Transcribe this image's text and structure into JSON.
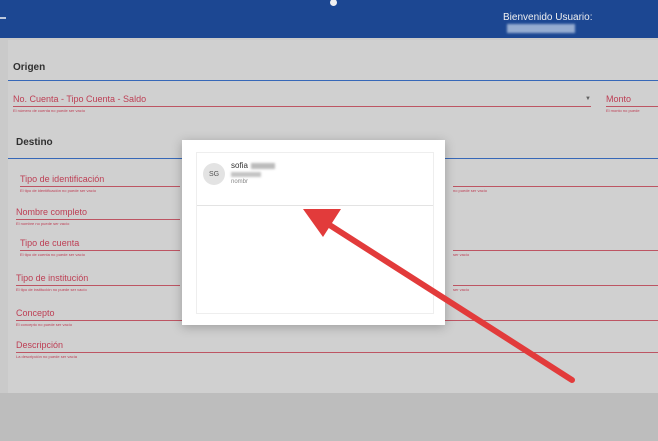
{
  "header": {
    "welcome": "Bienvenido Usuario:"
  },
  "origen": {
    "title": "Origen",
    "account_field": {
      "label": "No. Cuenta - Tipo Cuenta - Saldo",
      "error": "El número de cuenta no puede ser vacío"
    },
    "amount_field": {
      "label": "Monto",
      "error": "El monto no puede"
    }
  },
  "destino": {
    "title": "Destino",
    "fields": [
      {
        "label": "Tipo de identificación",
        "error": "El tipo de identificación no puede ser vacío"
      },
      {
        "label": "Nombre completo",
        "error": "El nombre no puede ser vacío"
      },
      {
        "label": "Tipo de cuenta",
        "error": "El tipo de cuenta no puede ser vacío"
      },
      {
        "label": "Tipo de institución",
        "error": "El tipo de institución no puede ser vacío"
      },
      {
        "label": "Concepto",
        "error": "El concepto no puede ser vacío"
      },
      {
        "label": "Descripción",
        "error": "La descripción no puede ser vacía"
      }
    ],
    "right_errors": [
      "no puede ser vacío",
      "ser vacío",
      "ser vacío"
    ]
  },
  "dialog": {
    "contact": {
      "initials": "SG",
      "name": "sofia",
      "subtitle": "nombr"
    }
  },
  "colors": {
    "header": "#1e4c9c",
    "error": "#c9435a",
    "arrow": "#e23b3b"
  }
}
